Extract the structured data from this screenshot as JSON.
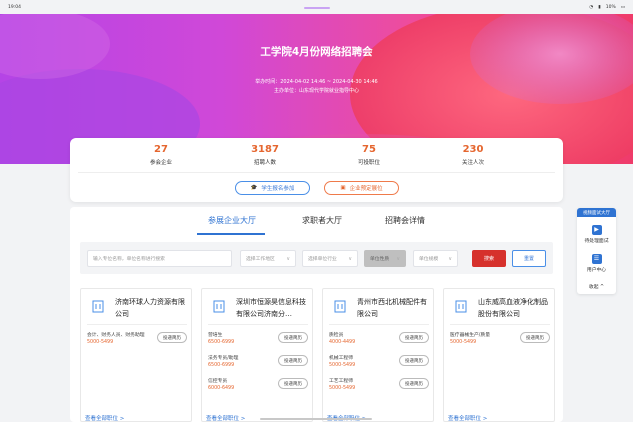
{
  "status_bar": {
    "time": "19:04",
    "battery": "10%"
  },
  "hero": {
    "title": "工学院4月份网络招聘会",
    "time_line": "举办时间：2024-04-02 14:46 ~ 2024-04-30 14:46",
    "host_line": "主办单位：山东现代学院就业指导中心"
  },
  "stats": [
    {
      "value": "27",
      "label": "参会企业"
    },
    {
      "value": "3187",
      "label": "招聘人数"
    },
    {
      "value": "75",
      "label": "可投职位"
    },
    {
      "value": "230",
      "label": "关注人次"
    }
  ],
  "actions": {
    "student_label": "学生报名参加",
    "company_label": "企业预定展位"
  },
  "tabs": [
    {
      "label": "参展企业大厅",
      "active": true
    },
    {
      "label": "求职者大厅",
      "active": false
    },
    {
      "label": "招聘会详情",
      "active": false
    }
  ],
  "filters": {
    "search_placeholder": "输入专位名称，单位名称进行搜索",
    "region": "选择工作地区",
    "industry": "选择单位行业",
    "nature": "单位性质",
    "scale": "单位规模",
    "search_btn": "搜索",
    "reset_btn": "重置"
  },
  "companies": [
    {
      "name": "济南环球人力资源有限公司",
      "jobs": [
        {
          "title": "会计、财务人员、财务助理",
          "salary": "5000-5499"
        }
      ]
    },
    {
      "name": "深圳市恒源昊信息科技有限公司济南分…",
      "jobs": [
        {
          "title": "营培生",
          "salary": "6500-6999"
        },
        {
          "title": "法务专员/助理",
          "salary": "6500-6999"
        },
        {
          "title": "信控专员",
          "salary": "6000-6499"
        }
      ]
    },
    {
      "name": "青州市西北机械配件有限公司",
      "jobs": [
        {
          "title": "质检员",
          "salary": "4000-4499"
        },
        {
          "title": "机械工程师",
          "salary": "5000-5499"
        },
        {
          "title": "工艺工程师",
          "salary": "5000-5499"
        }
      ]
    },
    {
      "name": "山东威高血液净化制品股份有限公司",
      "jobs": [
        {
          "title": "医疗器械生产/质量",
          "salary": "5000-5499"
        }
      ]
    }
  ],
  "apply_label": "投递简历",
  "view_all_label": "查看全部职位 >",
  "side_panel": {
    "header": "视频面试大厅",
    "pending": "待处理面试",
    "user_center": "用户中心",
    "collapse": "收起 ^"
  }
}
